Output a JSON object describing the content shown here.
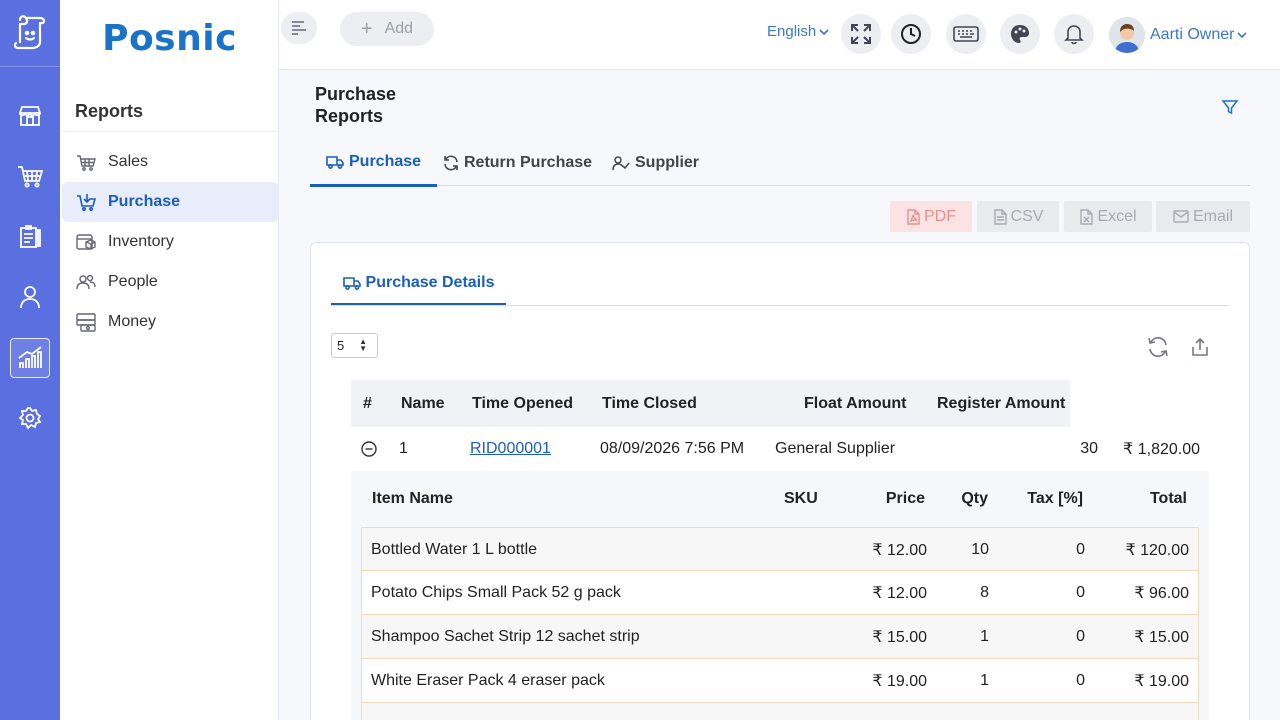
{
  "brand": {
    "name": "Posnic"
  },
  "rail": {
    "icons": [
      "logo-icon",
      "store-icon",
      "cart-icon",
      "clipboard-icon",
      "user-icon",
      "chart-icon",
      "settings-icon"
    ],
    "active": "chart-icon"
  },
  "sidebar": {
    "title": "Reports",
    "items": [
      {
        "label": "Sales",
        "icon": "basket-icon"
      },
      {
        "label": "Purchase",
        "icon": "cart-download-icon",
        "active": true
      },
      {
        "label": "Inventory",
        "icon": "boxes-icon"
      },
      {
        "label": "People",
        "icon": "people-icon"
      },
      {
        "label": "Money",
        "icon": "cash-icon"
      }
    ]
  },
  "topbar": {
    "add_label": "Add",
    "language": "English",
    "user_name": "Aarti Owner"
  },
  "page": {
    "title": "Purchase Reports",
    "tabs": [
      {
        "label": "Purchase",
        "active": true
      },
      {
        "label": "Return Purchase"
      },
      {
        "label": "Supplier"
      }
    ],
    "exports": [
      "PDF",
      "CSV",
      "Excel",
      "Email"
    ],
    "colors": {
      "accent": "#1a5fc0",
      "rail": "#5a6fe0",
      "pdf": "#e98f8f"
    }
  },
  "card": {
    "tab_label": "Purchase Details",
    "page_size": "5",
    "columns": [
      "#",
      "Name",
      "Time Opened",
      "Time Closed",
      "Float Amount",
      "Register Amount"
    ],
    "row": {
      "index": "1",
      "name": "RID000001",
      "time_opened": "08/09/2026 7:56 PM",
      "time_closed": "General Supplier",
      "float_amount": "30",
      "register_amount": "₹ 1,820.00"
    },
    "items": {
      "columns": [
        "Item Name",
        "SKU",
        "Price",
        "Qty",
        "Tax [%]",
        "Total"
      ],
      "rows": [
        {
          "name": "Bottled Water 1 L bottle",
          "sku": "",
          "price": "₹ 12.00",
          "qty": "10",
          "tax": "0",
          "total": "₹ 120.00"
        },
        {
          "name": "Potato Chips Small Pack 52 g pack",
          "sku": "",
          "price": "₹ 12.00",
          "qty": "8",
          "tax": "0",
          "total": "₹ 96.00"
        },
        {
          "name": "Shampoo Sachet Strip 12 sachet strip",
          "sku": "",
          "price": "₹ 15.00",
          "qty": "1",
          "tax": "0",
          "total": "₹ 15.00"
        },
        {
          "name": "White Eraser Pack 4 eraser pack",
          "sku": "",
          "price": "₹ 19.00",
          "qty": "1",
          "tax": "0",
          "total": "₹ 19.00"
        }
      ]
    }
  }
}
